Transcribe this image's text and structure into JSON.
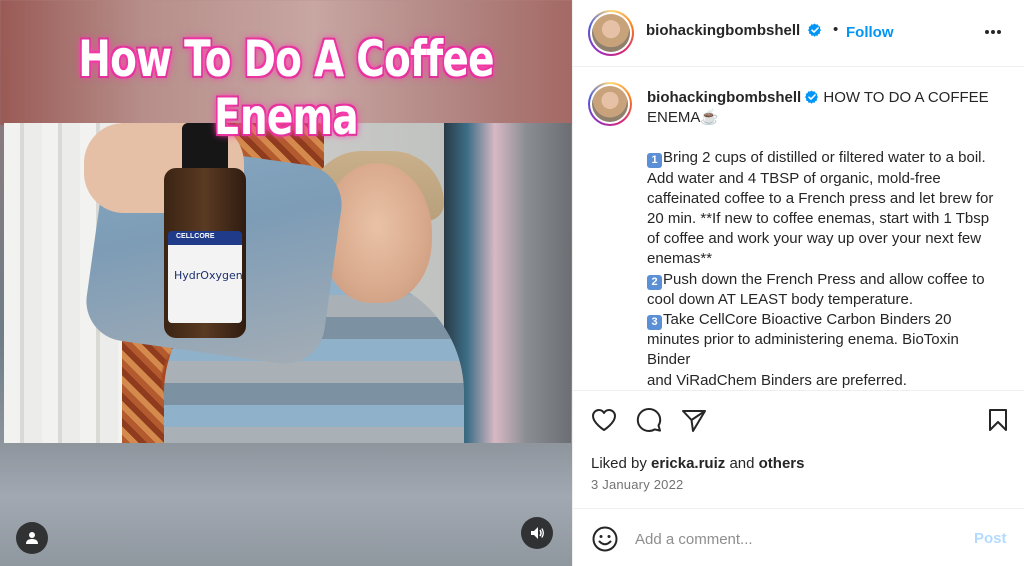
{
  "media": {
    "overlay_title": "How To Do A Coffee Enema",
    "bottle_brand": "CELLCORE",
    "bottle_label": "HydrOxygen"
  },
  "header": {
    "username": "biohackingbombshell",
    "separator": "•",
    "follow_label": "Follow"
  },
  "caption": {
    "username": "biohackingbombshell",
    "title": "HOW TO DO A COFFEE ENEMA☕",
    "steps": [
      {
        "num": "1",
        "text": "Bring 2 cups of distilled or filtered water to a boil. Add water and 4 TBSP of organic, mold-free caffeinated coffee to a French press and let brew for 20 min. **If new to coffee enemas, start with 1 Tbsp of coffee and work your way up over your next few enemas**"
      },
      {
        "num": "2",
        "text": "Push down the French Press and allow coffee to cool down AT LEAST body temperature."
      },
      {
        "num": "3",
        "text": "Take CellCore Bioactive Carbon Binders 20 minutes prior to administering enema. BioToxin Binder"
      }
    ],
    "continuation": "and ViRadChem Binders are preferred."
  },
  "engagement": {
    "liked_by_prefix": "Liked by",
    "liked_by_user": "ericka.ruiz",
    "liked_by_and": "and",
    "liked_by_others": "others",
    "date": "3 January 2022"
  },
  "comment": {
    "placeholder": "Add a comment...",
    "post_label": "Post"
  },
  "colors": {
    "accent": "#0095f6",
    "post_disabled": "#b3dbff",
    "verified": "#0095f6",
    "title_glow": "#ff3fb0"
  }
}
